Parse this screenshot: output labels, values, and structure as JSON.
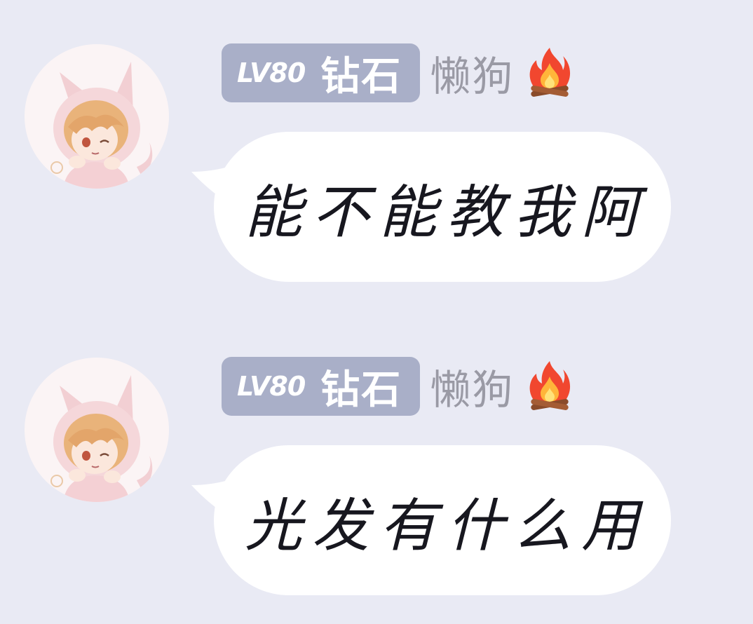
{
  "messages": [
    {
      "badge": {
        "level": "LV80",
        "tier": "钻石"
      },
      "nickname": "懒狗",
      "nickname_icon": "fire-icon",
      "avatar_icon": "anime-catgirl-avatar",
      "text": "能不能教我阿"
    },
    {
      "badge": {
        "level": "LV80",
        "tier": "钻石"
      },
      "nickname": "懒狗",
      "nickname_icon": "fire-icon",
      "avatar_icon": "anime-catgirl-avatar",
      "text": "光发有什么用"
    }
  ],
  "colors": {
    "background": "#e9eaf4",
    "badge_bg": "#a9afc8",
    "nickname": "#9a9aa5",
    "bubble": "#ffffff",
    "text": "#17171f"
  }
}
